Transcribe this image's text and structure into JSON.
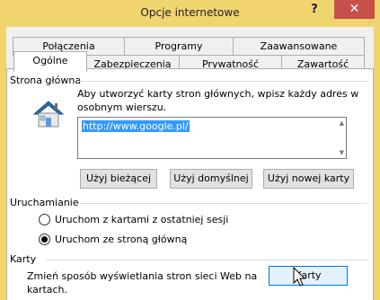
{
  "window": {
    "title": "Opcje internetowe",
    "help_label": "?",
    "close_label": "✕"
  },
  "tabs": {
    "row1": [
      {
        "label": "Połączenia"
      },
      {
        "label": "Programy"
      },
      {
        "label": "Zaawansowane"
      }
    ],
    "row2": [
      {
        "label": "Ogólne",
        "active": true
      },
      {
        "label": "Zabezpieczenia"
      },
      {
        "label": "Prywatność"
      },
      {
        "label": "Zawartość"
      }
    ]
  },
  "homepage": {
    "group_label": "Strona główna",
    "icon": "house-icon",
    "description_line1": "Aby utworzyć karty stron głównych, wpisz każdy adres w",
    "description_line2": "osobnym wierszu.",
    "url_value": "http://www.google.pl/",
    "buttons": {
      "use_current": "Użyj bieżącej",
      "use_default": "Użyj domyślnej",
      "use_new_tab": "Użyj nowej karty"
    }
  },
  "startup": {
    "group_label": "Uruchamianie",
    "options": [
      {
        "label": "Uruchom z kartami z ostatniej sesji",
        "selected": false
      },
      {
        "label": "Uruchom ze stroną główną",
        "selected": true
      }
    ]
  },
  "tabs_section": {
    "group_label": "Karty",
    "description_line1": "Zmień sposób wyświetlania stron sieci Web na",
    "description_line2": "kartach.",
    "button_label": "Karty"
  },
  "colors": {
    "titlebar": "#f0d470",
    "close_button": "#c7504a",
    "selection": "#3399ff",
    "button_hover_border": "#0078d7"
  }
}
